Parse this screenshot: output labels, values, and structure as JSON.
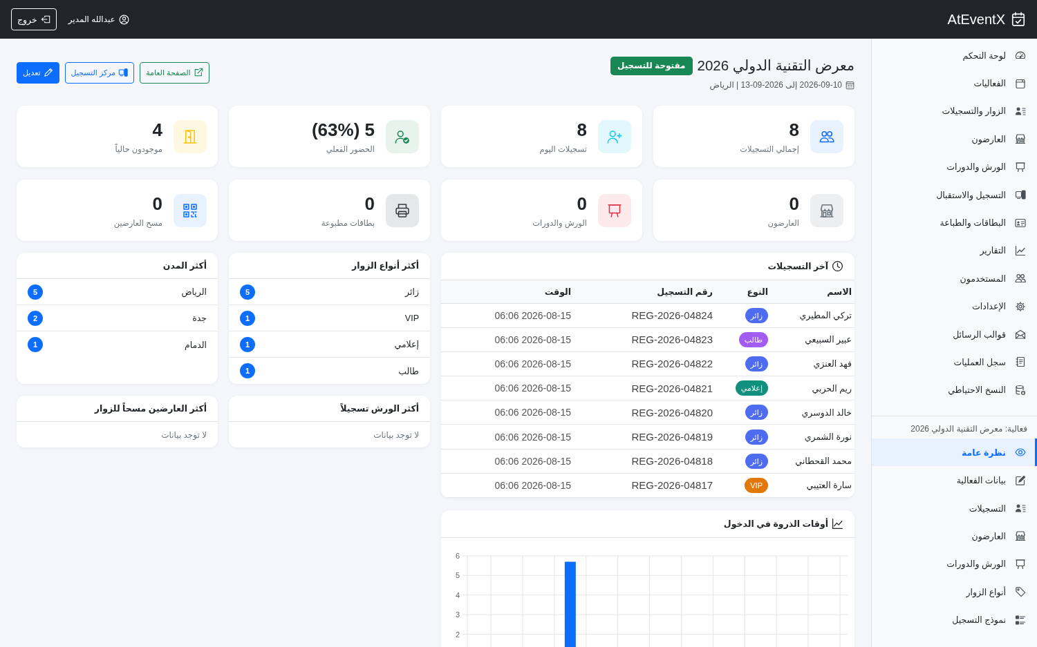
{
  "header": {
    "brand": "AtEventX",
    "user": "عبدالله المدير",
    "logout": "خروج"
  },
  "sidebar": {
    "items": [
      {
        "label": "لوحة التحكم",
        "selected": false
      },
      {
        "label": "الفعاليات",
        "selected": false
      },
      {
        "label": "الزوار والتسجيلات",
        "selected": false
      },
      {
        "label": "العارضون",
        "selected": false
      },
      {
        "label": "الورش والدورات",
        "selected": false
      },
      {
        "label": "التسجيل والاستقبال",
        "selected": false
      },
      {
        "label": "البطاقات والطباعة",
        "selected": false
      },
      {
        "label": "التقارير",
        "selected": false
      },
      {
        "label": "المستخدمون",
        "selected": false
      },
      {
        "label": "الإعدادات",
        "selected": false
      },
      {
        "label": "قوالب الرسائل",
        "selected": false
      },
      {
        "label": "سجل العمليات",
        "selected": false
      },
      {
        "label": "النسخ الاحتياطي",
        "selected": false
      }
    ],
    "event_heading": "فعالية: معرض التقنية الدولي 2026",
    "event_items": [
      {
        "label": "نظرة عامة",
        "selected": true
      },
      {
        "label": "بيانات الفعالية",
        "selected": false
      },
      {
        "label": "التسجيلات",
        "selected": false
      },
      {
        "label": "العارضون",
        "selected": false
      },
      {
        "label": "الورش والدورات",
        "selected": false
      },
      {
        "label": "أنواع الزوار",
        "selected": false
      },
      {
        "label": "نموذج التسجيل",
        "selected": false
      }
    ]
  },
  "event": {
    "title": "معرض التقنية الدولي 2026",
    "status_badge": "مفتوحة للتسجيل",
    "dates": "2026-09-10 إلى 2026-09-13 | الرياض",
    "actions": [
      {
        "label": "الصفحة العامة",
        "kind": "outline-success"
      },
      {
        "label": "مركز التسجيل",
        "kind": "outline-primary"
      },
      {
        "label": "تعديل",
        "kind": "primary"
      }
    ]
  },
  "stats": [
    {
      "value": "8",
      "label": "إجمالي التسجيلات"
    },
    {
      "value": "8",
      "label": "تسجيلات اليوم"
    },
    {
      "value": "5 (63%)",
      "label": "الحضور الفعلي"
    },
    {
      "value": "4",
      "label": "موجودون حالياً"
    },
    {
      "value": "0",
      "label": "العارضون"
    },
    {
      "value": "0",
      "label": "الورش والدورات"
    },
    {
      "value": "0",
      "label": "بطاقات مطبوعة"
    },
    {
      "value": "0",
      "label": "مسح العارضين"
    }
  ],
  "recent_registrations": {
    "title": "آخر التسجيلات",
    "columns": [
      "الاسم",
      "النوع",
      "رقم التسجيل",
      "الوقت"
    ],
    "rows": [
      {
        "name": "تركي المطيري",
        "type": "زائر",
        "color": "#4e6cef",
        "reg_no": "REG-2026-04824",
        "time": "2026-08-15 06:06"
      },
      {
        "name": "عبير السبيعي",
        "type": "طالب",
        "color": "#a25cf2",
        "reg_no": "REG-2026-04823",
        "time": "2026-08-15 06:06"
      },
      {
        "name": "فهد العنزي",
        "type": "زائر",
        "color": "#4e6cef",
        "reg_no": "REG-2026-04822",
        "time": "2026-08-15 06:06"
      },
      {
        "name": "ريم الحربي",
        "type": "إعلامي",
        "color": "#11917d",
        "reg_no": "REG-2026-04821",
        "time": "2026-08-15 06:06"
      },
      {
        "name": "خالد الدوسري",
        "type": "زائر",
        "color": "#4e6cef",
        "reg_no": "REG-2026-04820",
        "time": "2026-08-15 06:06"
      },
      {
        "name": "نورة الشمري",
        "type": "زائر",
        "color": "#4e6cef",
        "reg_no": "REG-2026-04819",
        "time": "2026-08-15 06:06"
      },
      {
        "name": "محمد القحطاني",
        "type": "زائر",
        "color": "#4e6cef",
        "reg_no": "REG-2026-04818",
        "time": "2026-08-15 06:06"
      },
      {
        "name": "سارة العتيبي",
        "type": "VIP",
        "color": "#e2780c",
        "reg_no": "REG-2026-04817",
        "time": "2026-08-15 06:06"
      }
    ]
  },
  "peak_times": {
    "title": "أوقات الذروة في الدخول",
    "chart_data": {
      "type": "bar",
      "ylim": [
        0,
        6
      ],
      "yticks": [
        2,
        3,
        4,
        5,
        6
      ],
      "grid": true,
      "values": [
        0,
        0,
        0,
        5.7,
        0,
        0,
        0,
        0,
        0,
        0,
        0,
        0
      ]
    }
  },
  "top_visitor_types": {
    "title": "أكثر أنواع الزوار",
    "items": [
      {
        "label": "زائر",
        "count": "5"
      },
      {
        "label": "VIP",
        "count": "1"
      },
      {
        "label": "إعلامي",
        "count": "1"
      },
      {
        "label": "طالب",
        "count": "1"
      }
    ]
  },
  "top_cities": {
    "title": "أكثر المدن",
    "items": [
      {
        "label": "الرياض",
        "count": "5"
      },
      {
        "label": "جدة",
        "count": "2"
      },
      {
        "label": "الدمام",
        "count": "1"
      }
    ]
  },
  "top_workshops": {
    "title": "أكثر الورش تسجيلاً",
    "empty": "لا توجد بيانات"
  },
  "top_exhibitors": {
    "title": "أكثر العارضين مسحاً للزوار",
    "empty": "لا توجد بيانات"
  }
}
